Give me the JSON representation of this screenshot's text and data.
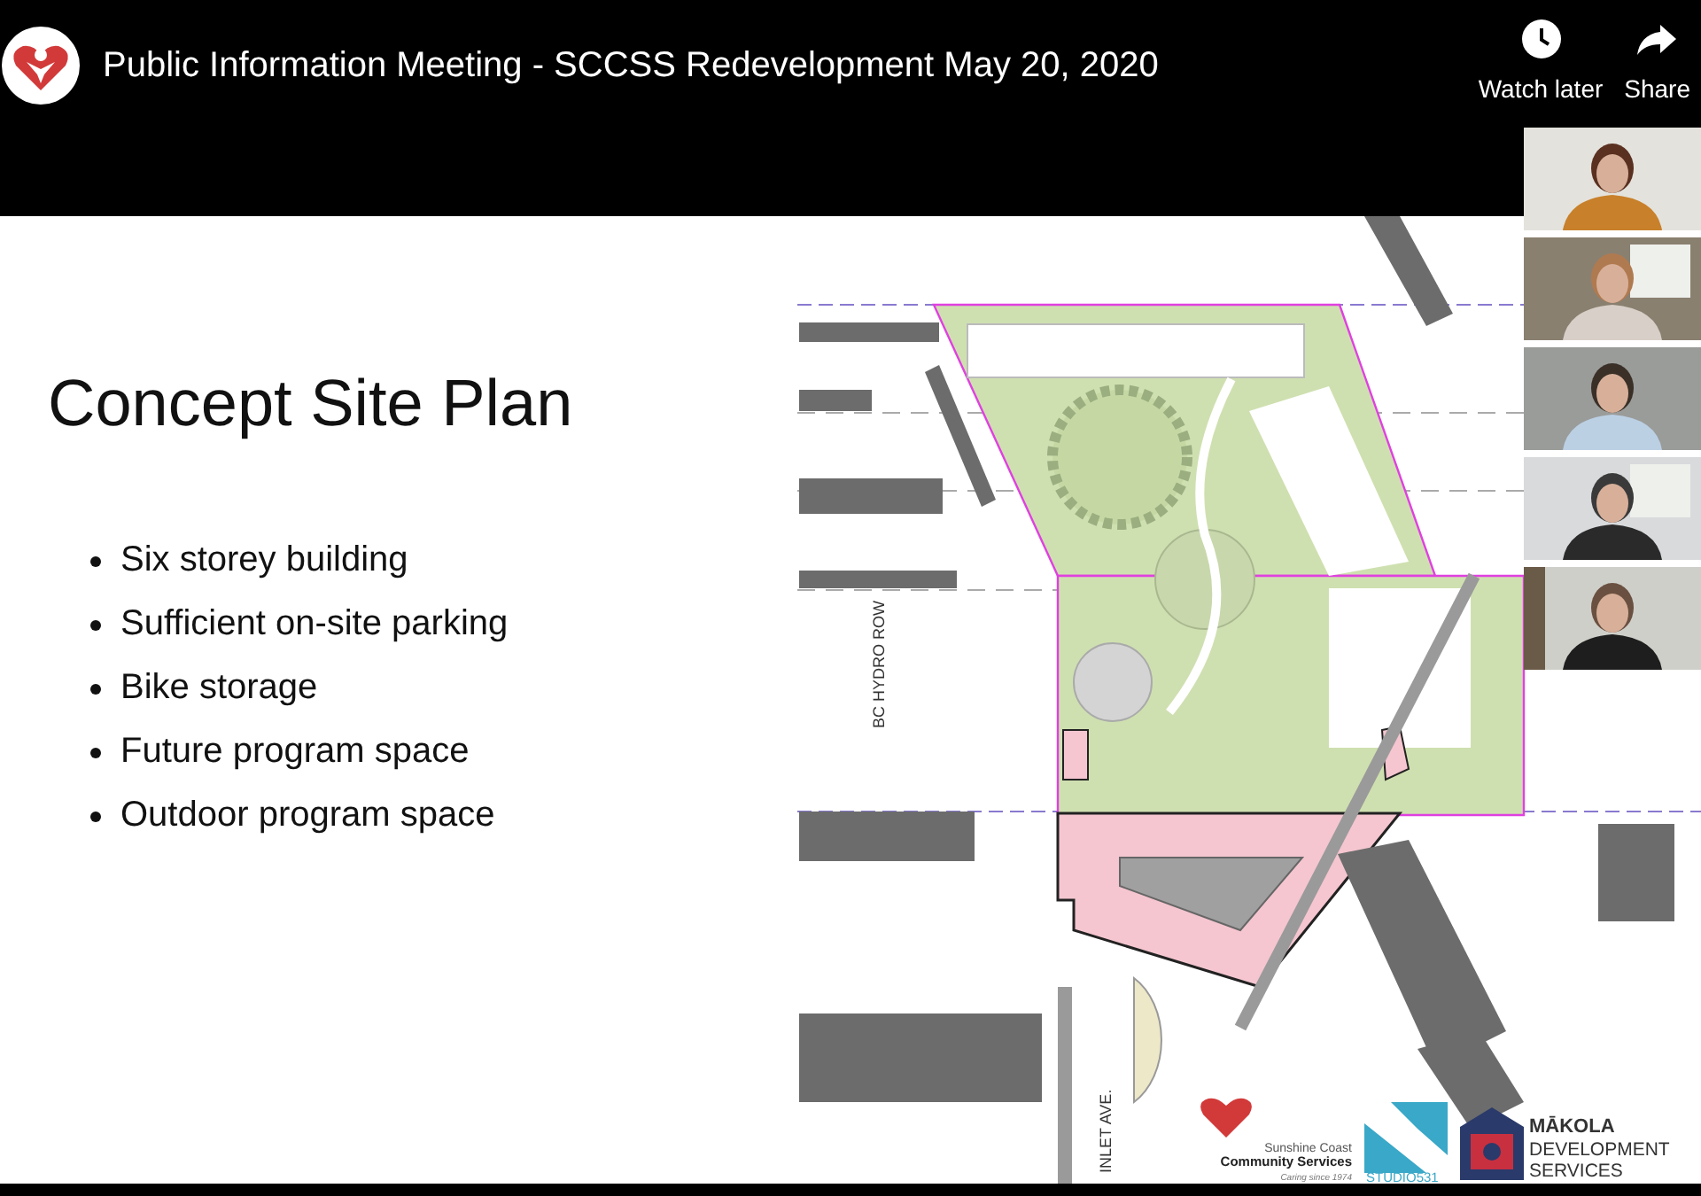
{
  "video": {
    "title": "Public Information Meeting - SCCSS Redevelopment May 20, 2020",
    "actions": [
      {
        "label": "Watch later",
        "kind": "clock"
      },
      {
        "label": "Share",
        "kind": "share"
      }
    ]
  },
  "slide": {
    "title": "Concept Site Plan",
    "bullets": [
      "Six storey building",
      "Sufficient on-site parking",
      "Bike storage",
      "Future program space",
      "Outdoor program space"
    ],
    "plan_labels": {
      "hydro_row": "BC HYDRO ROW",
      "street": "INLET AVE."
    },
    "sccs_logo": {
      "line1": "Sunshine Coast",
      "line2": "Community Services",
      "tagline": "Caring since 1974"
    },
    "studio_logo": "STUDIO531",
    "makola_logo": {
      "line1": "MĀKOLA",
      "line2": "DEVELOPMENT",
      "line3": "SERVICES"
    }
  }
}
